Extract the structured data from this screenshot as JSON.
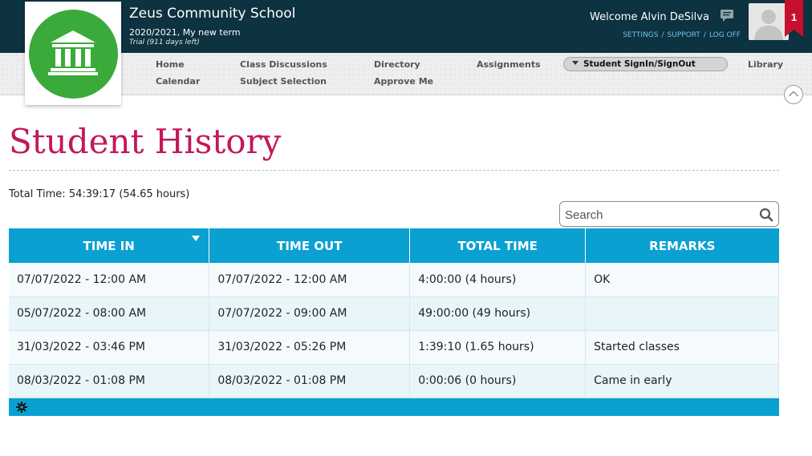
{
  "header": {
    "school_name": "Zeus Community School",
    "term": "2020/2021, My new term",
    "trial": "Trial (911 days left)",
    "welcome": "Welcome Alvin DeSilva",
    "links": {
      "settings": "SETTINGS",
      "support": "SUPPORT",
      "logoff": "LOG OFF",
      "separator": "/"
    },
    "notification_count": "1"
  },
  "nav": {
    "home": "Home",
    "calendar": "Calendar",
    "class_discussions": "Class Discussions",
    "subject_selection": "Subject Selection",
    "directory": "Directory",
    "approve_me": "Approve Me",
    "assignments": "Assignments",
    "student_signin": "Student SignIn/SignOut",
    "library": "Library"
  },
  "page": {
    "title": "Student History",
    "total_time": "Total Time: 54:39:17  (54.65 hours)"
  },
  "search": {
    "placeholder": "Search"
  },
  "table": {
    "columns": [
      "TIME IN",
      "TIME OUT",
      "TOTAL TIME",
      "REMARKS"
    ],
    "rows": [
      [
        "07/07/2022 - 12:00 AM",
        "07/07/2022 - 12:00 AM",
        "4:00:00  (4 hours)",
        "OK"
      ],
      [
        "05/07/2022 - 08:00 AM",
        "07/07/2022 - 09:00 AM",
        "49:00:00  (49 hours)",
        ""
      ],
      [
        "31/03/2022 - 03:46 PM",
        "31/03/2022 - 05:26 PM",
        "1:39:10  (1.65 hours)",
        "Started classes"
      ],
      [
        "08/03/2022 - 01:08 PM",
        "08/03/2022 - 01:08 PM",
        "0:00:06  (0 hours)",
        "Came in early"
      ]
    ]
  },
  "colors": {
    "header_bg": "#0d3240",
    "accent_blue": "#0aa0d2",
    "title_pink": "#c2185b",
    "logo_green": "#3aaa3a",
    "badge_red": "#c8102e"
  },
  "icons": [
    "school-building-icon",
    "chat-icon",
    "user-avatar-icon",
    "sort-desc-icon",
    "search-icon",
    "gear-icon",
    "collapse-up-icon",
    "dropdown-caret-icon"
  ]
}
